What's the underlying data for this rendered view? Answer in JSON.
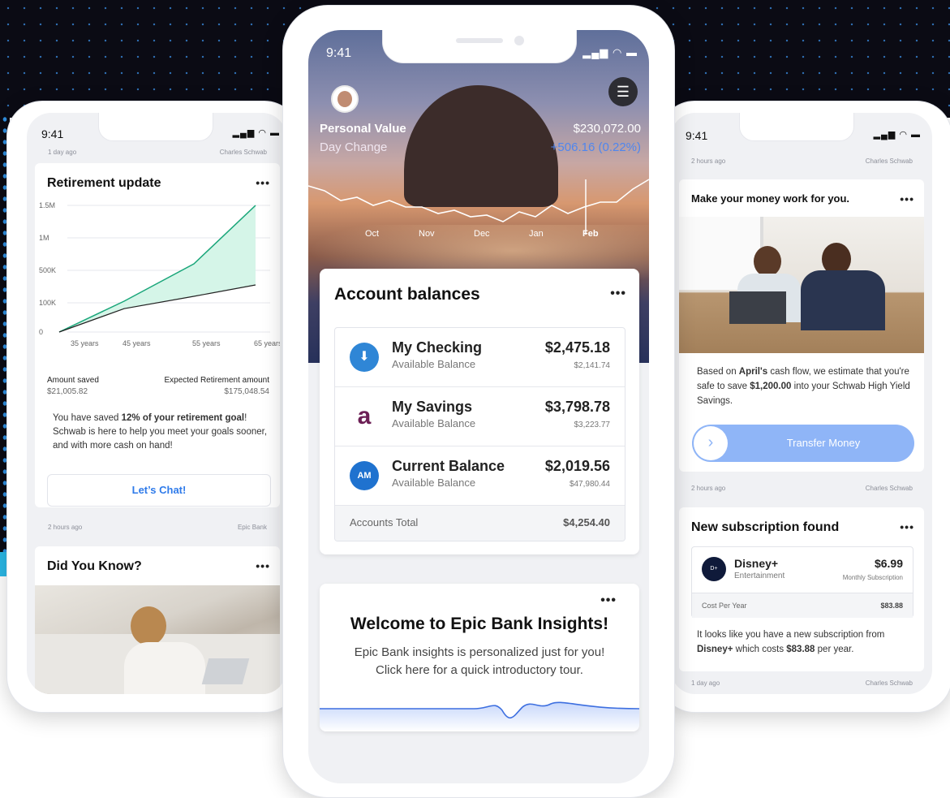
{
  "colors": {
    "accent": "#2f7bea",
    "green": "#1aa67a",
    "transfer": "#8fb5f7"
  },
  "left_phone": {
    "status_time": "9:41",
    "meta_top": {
      "left": "1 day ago",
      "right": "Charles Schwab"
    },
    "retirement": {
      "title": "Retirement update",
      "menu": "•••",
      "y_ticks": [
        "1.5M",
        "1M",
        "500K",
        "100K",
        "0"
      ],
      "x_ticks": [
        "35 years",
        "45 years",
        "55 years",
        "65 years"
      ],
      "amount_saved_label": "Amount saved",
      "amount_saved": "$21,005.82",
      "expected_label": "Expected Retirement amount",
      "expected": "$175,048.54",
      "message_pre": "You have saved ",
      "message_bold": "12% of your retirement goal",
      "message_post": "! Schwab is here to help you meet your goals sooner, and with more cash on hand!",
      "chat_button": "Let’s Chat!"
    },
    "meta_mid": {
      "left": "2 hours ago",
      "right": "Epic Bank"
    },
    "did_you_know": {
      "title": "Did You Know?",
      "menu": "•••"
    }
  },
  "chart_data": {
    "type": "area",
    "x": [
      "35 years",
      "45 years",
      "55 years",
      "65 years"
    ],
    "y_ticks": [
      "1.5M",
      "1M",
      "500K",
      "100K",
      "0"
    ],
    "series": [
      {
        "values": [
          0,
          120000,
          600000,
          1500000
        ],
        "color": "#1aa67a"
      },
      {
        "values": [
          0,
          80000,
          180000,
          320000
        ],
        "color": "#222222"
      }
    ]
  },
  "center_phone": {
    "status_time": "9:41",
    "hero": {
      "personal_value_label": "Personal Value",
      "personal_value": "$230,072.00",
      "day_change_label": "Day Change",
      "day_change": "+506.16 (0.22%)",
      "months": [
        "Oct",
        "Nov",
        "Dec",
        "Jan",
        "Feb"
      ]
    },
    "balances": {
      "title": "Account balances",
      "menu": "•••",
      "accounts": [
        {
          "name": "My Checking",
          "sub": "Available Balance",
          "amount": "$2,475.18",
          "secondary": "$2,141.74"
        },
        {
          "name": "My Savings",
          "sub": "Available Balance",
          "amount": "$3,798.78",
          "secondary": "$3,223.77"
        },
        {
          "name": "Current Balance",
          "sub": "Available Balance",
          "amount": "$2,019.56",
          "secondary": "$47,980.44"
        }
      ],
      "total_label": "Accounts Total",
      "total": "$4,254.40"
    },
    "welcome": {
      "menu": "•••",
      "title": "Welcome to Epic Bank Insights!",
      "body_line1": "Epic Bank insights is personalized just for you!",
      "body_line2": "Click here for a quick introductory tour."
    }
  },
  "right_phone": {
    "status_time": "9:41",
    "meta_top": {
      "left": "2 hours ago",
      "right": "Charles Schwab"
    },
    "money": {
      "title": "Make your money work for you.",
      "menu": "•••",
      "text_pre": "Based on ",
      "text_bold1": "April's",
      "text_mid": " cash flow, we estimate that you're safe to save ",
      "text_bold2": "$1,200.00",
      "text_post": " into your Schwab High Yield Savings.",
      "transfer_label": "Transfer Money"
    },
    "meta_mid": {
      "left": "2 hours ago",
      "right": "Charles Schwab"
    },
    "subscription": {
      "title": "New subscription found",
      "menu": "•••",
      "name": "Disney+",
      "category": "Entertainment",
      "price": "$6.99",
      "price_label": "Monthly Subscription",
      "cost_label": "Cost Per Year",
      "cost": "$83.88",
      "note_pre": "It looks like you have a new subscription from ",
      "note_bold1": "Disney+",
      "note_mid": " which costs ",
      "note_bold2": "$83.88",
      "note_post": " per year."
    },
    "meta_bottom": {
      "left": "1 day ago",
      "right": "Charles Schwab"
    }
  }
}
